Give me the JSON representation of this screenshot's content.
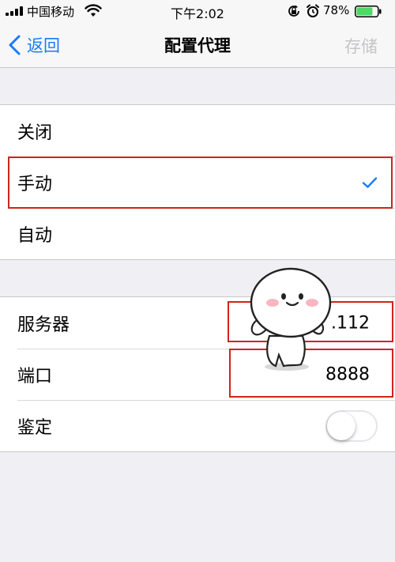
{
  "status_bar": {
    "carrier": "中国移动",
    "time": "下午2:02",
    "battery_percent": "78%",
    "battery_level": 0.78,
    "icons": [
      "signal-icon",
      "wifi-icon",
      "orientation-lock-icon",
      "alarm-icon",
      "battery-icon"
    ]
  },
  "nav": {
    "back_label": "返回",
    "title": "配置代理",
    "save_label": "存储"
  },
  "proxy_modes": {
    "items": [
      {
        "label": "关闭",
        "selected": false
      },
      {
        "label": "手动",
        "selected": true
      },
      {
        "label": "自动",
        "selected": false
      }
    ]
  },
  "manual_settings": {
    "server_label": "服务器",
    "server_value": ".112",
    "port_label": "端口",
    "port_value": "8888",
    "auth_label": "鉴定",
    "auth_enabled": false
  },
  "colors": {
    "accent": "#1a7cf5",
    "highlight": "#d0231e",
    "background": "#efeff4"
  }
}
